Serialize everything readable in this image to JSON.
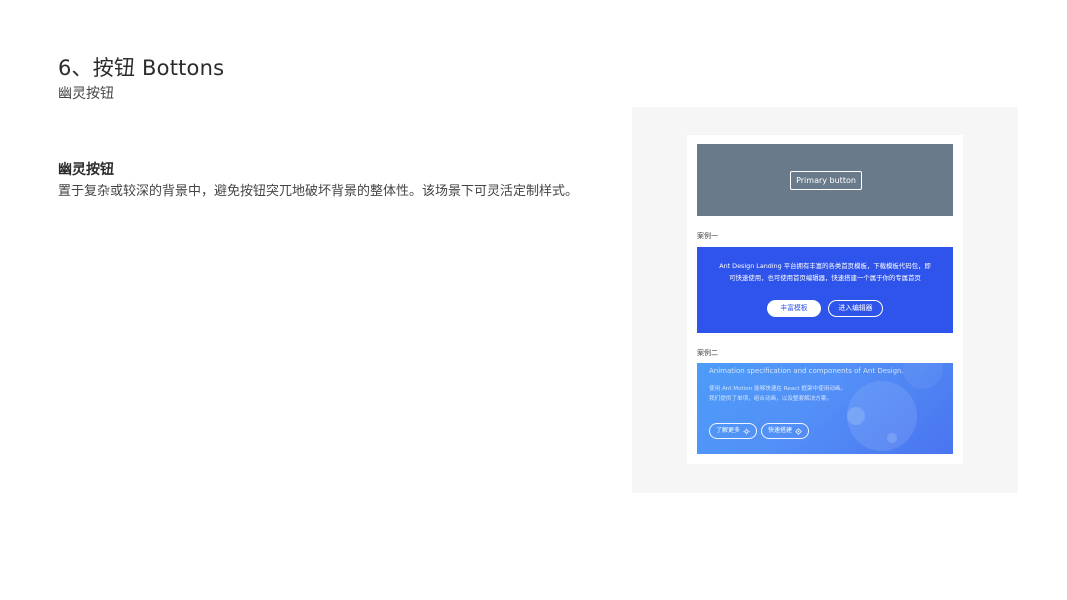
{
  "header": {
    "title": "6、按钮 Bottons",
    "subtitle": "幽灵按钮"
  },
  "section": {
    "heading": "幽灵按钮",
    "description": "置于复杂或较深的背景中，避免按钮突兀地破坏背景的整体性。该场景下可灵活定制样式。"
  },
  "preview": {
    "primary_button_label": "Primary button",
    "case1": {
      "label": "案例一",
      "text_line1": "Ant Design Landing 平台拥有丰富的各类首页模板，下载模板代码包，即",
      "text_line2": "可快速使用，也可使用首页编辑器，快速搭建一个属于你的专属首页",
      "button_solid": "丰富模板",
      "button_ghost": "进入编辑器",
      "background_color": "#2f54eb"
    },
    "case2": {
      "label": "案例二",
      "title": "Animation specification and components of Ant Design.",
      "desc_line1": "使用 Ant Motion 能够快速在 React 框架中使用动画。",
      "desc_line2": "我们提供了单项，组合动画，以及整套解决方案。",
      "button1": "了解更多",
      "button1_icon": "settings-icon",
      "button2": "快速搭建",
      "button2_icon": "target-icon"
    },
    "primary_demo_bg": "#697b8b"
  }
}
